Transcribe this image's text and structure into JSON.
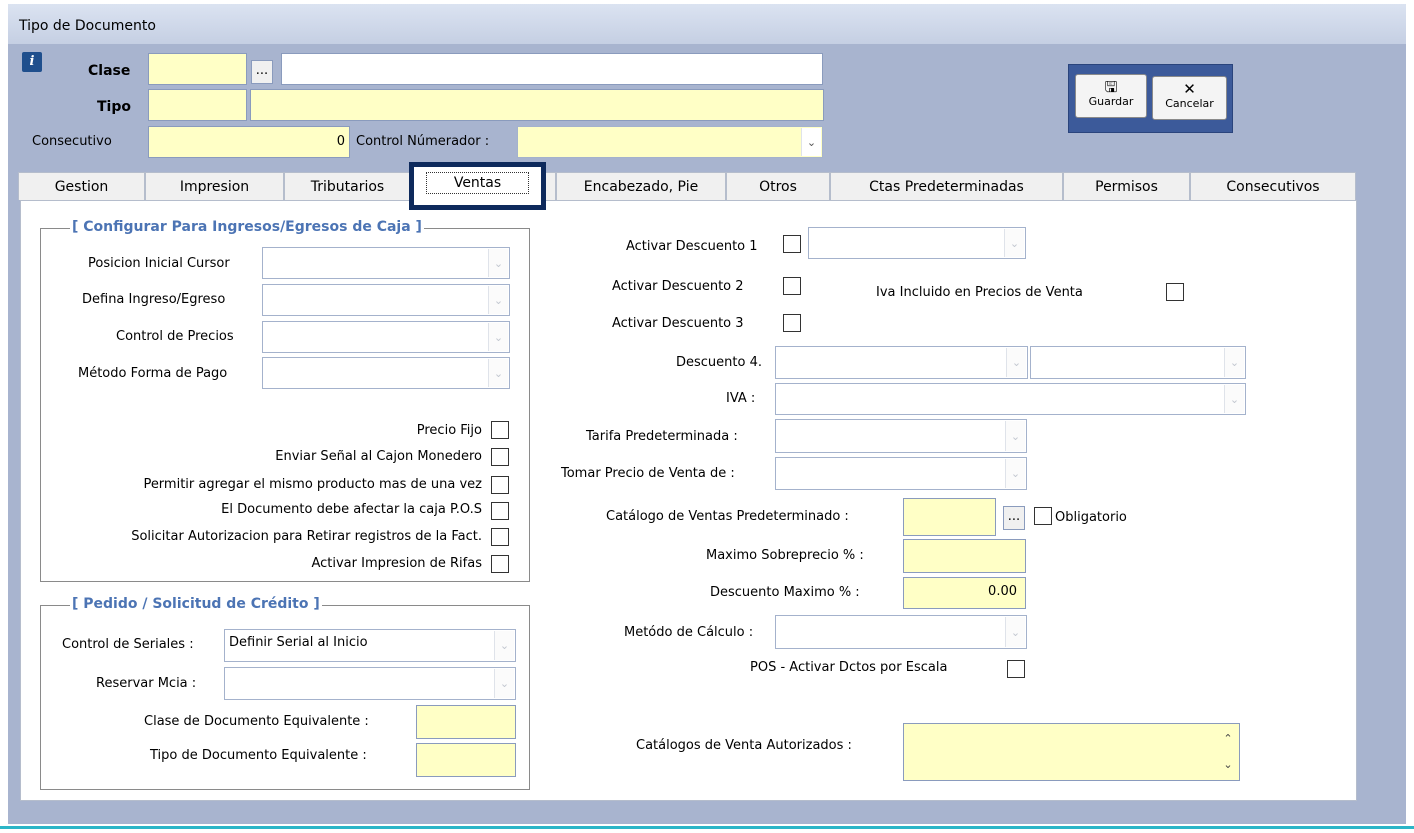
{
  "window": {
    "title": "Tipo de Documento"
  },
  "header": {
    "clase_label": "Clase",
    "tipo_label": "Tipo",
    "consecutivo_label": "Consecutivo",
    "consecutivo_value": "0",
    "control_numerador_label": "Control Númerador :",
    "browse_label": "..."
  },
  "toolbar": {
    "save_label": "Guardar",
    "cancel_label": "Cancelar"
  },
  "tabs": [
    {
      "label": "Gestion"
    },
    {
      "label": "Impresion"
    },
    {
      "label": "Tributarios"
    },
    {
      "label": "Ventas"
    },
    {
      "label": "Encabezado, Pie"
    },
    {
      "label": "Otros"
    },
    {
      "label": "Ctas Predeterminadas"
    },
    {
      "label": "Permisos"
    },
    {
      "label": "Consecutivos"
    }
  ],
  "caja_group": {
    "title": "[ Configurar Para  Ingresos/Egresos de Caja ]",
    "posicion_label": "Posicion Inicial Cursor",
    "defina_label": "Defina Ingreso/Egreso",
    "control_precios_label": "Control de Precios",
    "metodo_pago_label": "Método Forma de Pago",
    "checks": [
      {
        "label": "Precio Fijo"
      },
      {
        "label": "Enviar Señal al Cajon Monedero"
      },
      {
        "label": "Permitir agregar el mismo producto mas de una vez"
      },
      {
        "label": "El Documento debe afectar la caja P.O.S"
      },
      {
        "label": "Solicitar Autorizacion para Retirar registros de la Fact."
      },
      {
        "label": "Activar Impresion de Rifas"
      }
    ]
  },
  "pedido_group": {
    "title": "[ Pedido / Solicitud de Crédito ]",
    "seriales_label": "Control de Seriales :",
    "seriales_value": "Definir Serial al Inicio",
    "reservar_label": "Reservar Mcia :",
    "clase_equiv_label": "Clase  de Documento Equivalente :",
    "tipo_equiv_label": "Tipo  de Documento Equivalente :"
  },
  "right": {
    "desc1_label": "Activar Descuento 1",
    "desc2_label": "Activar Descuento 2",
    "desc3_label": "Activar Descuento 3",
    "iva_incluido_label": "Iva Incluido en  Precios de Venta",
    "desc4_label": "Descuento 4.",
    "iva_label": "IVA :",
    "tarifa_label": "Tarifa Predeterminada :",
    "tomar_precio_label": "Tomar Precio de Venta de :",
    "catalogo_label": "Catálogo de Ventas Predeterminado :",
    "obligatorio_label": "Obligatorio",
    "max_sobreprecio_label": "Maximo Sobreprecio  % :",
    "desc_max_label": "Descuento Maximo  % :",
    "desc_max_value": "0.00",
    "metodo_calculo_label": "Metódo de Cálculo :",
    "pos_escala_label": "POS - Activar Dctos por Escala",
    "catalogos_autorizados_label": "Catálogos de Venta Autorizados :"
  }
}
